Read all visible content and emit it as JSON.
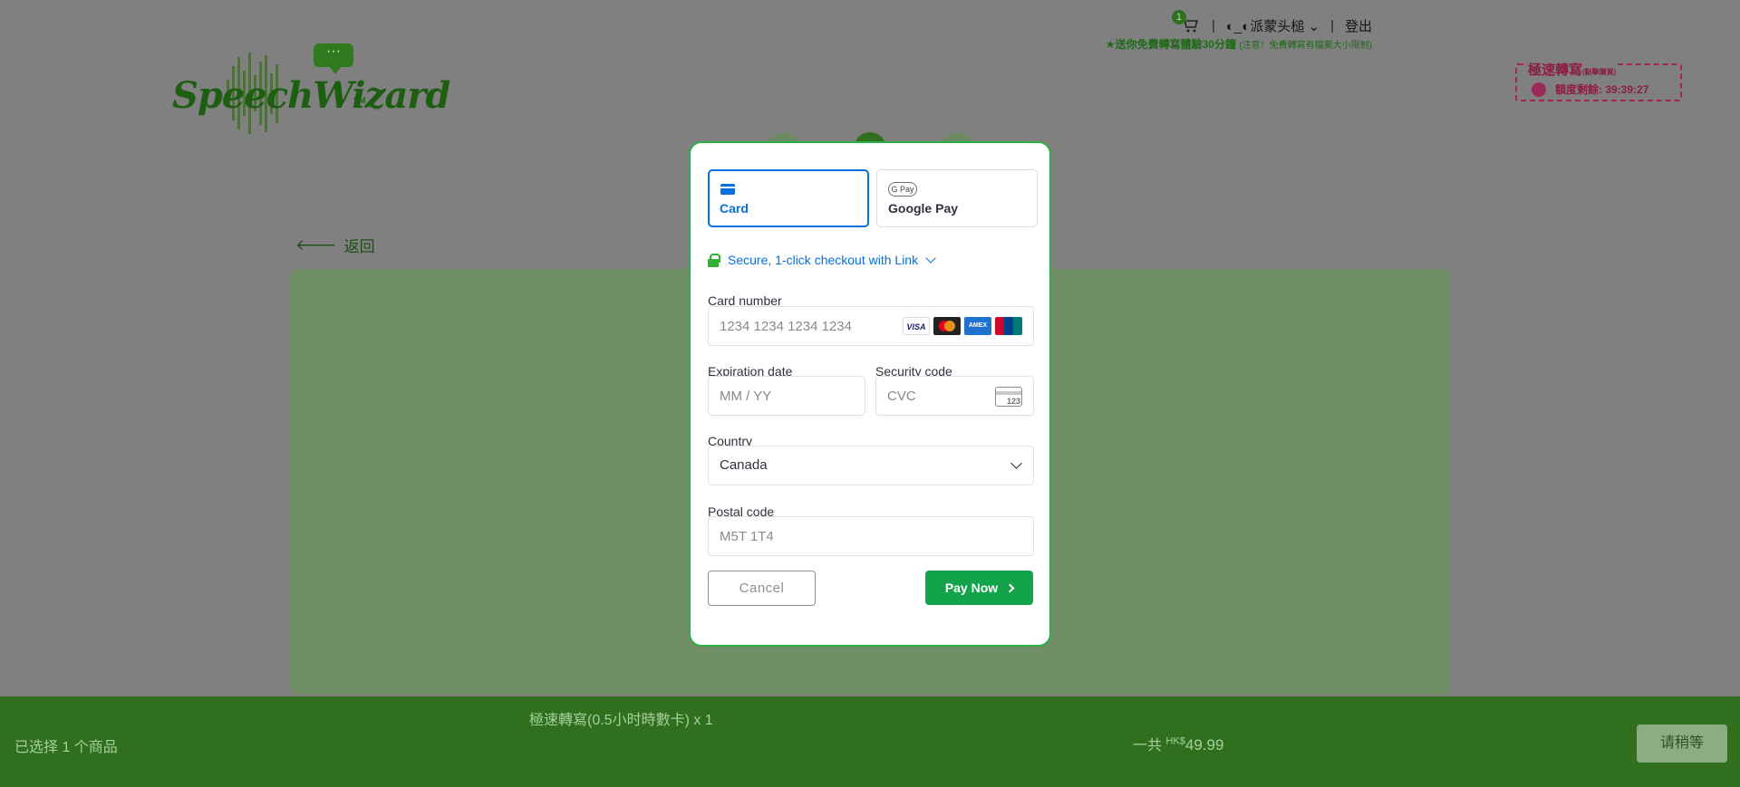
{
  "header": {
    "logo_text": "SpeechWizard",
    "logo_suffix": "VM",
    "logo_bubble": "···",
    "cart_count": "1",
    "user_name": "◐_◐派蒙头槌",
    "logout": "登出",
    "promo": "★送你免費轉寫體驗30分鐘",
    "promo_note": "(注意！免費轉寫有檔案大小限制)",
    "quota_title": "極速轉寫",
    "quota_note": "(點擊購買)",
    "quota_remaining": "額度剩餘: 39:39:27"
  },
  "page": {
    "back_label": "返回"
  },
  "payment_modal": {
    "tabs": [
      {
        "label": "Card",
        "icon": "card-icon",
        "active": true
      },
      {
        "label": "Google Pay",
        "icon": "google-pay-icon",
        "badge": "G Pay",
        "active": false
      }
    ],
    "link_checkout": "Secure, 1-click checkout with Link",
    "card_number_label": "Card number",
    "card_number_placeholder": "1234 1234 1234 1234",
    "card_brands": [
      "VISA",
      "Mastercard",
      "AMEX",
      "UnionPay"
    ],
    "expiration_label": "Expiration date",
    "expiration_placeholder": "MM / YY",
    "security_label": "Security code",
    "security_placeholder": "CVC",
    "cvc_icon_text": "123",
    "country_label": "Country",
    "country_value": "Canada",
    "postal_label": "Postal code",
    "postal_placeholder": "M5T 1T4",
    "cancel_label": "Cancel",
    "pay_label": "Pay Now"
  },
  "footer": {
    "selected_count": "已选择 1 个商品",
    "item_line": "極速轉寫(0.5小时時數卡) x 1",
    "total_prefix": "一共",
    "currency": "HK$",
    "total_amount": "49.99",
    "wait_button": "请稍等"
  },
  "colors": {
    "brand_green": "#2f6f1e",
    "pay_green": "#13a34a",
    "stripe_blue": "#0570de",
    "quota_red": "#a4254f"
  }
}
